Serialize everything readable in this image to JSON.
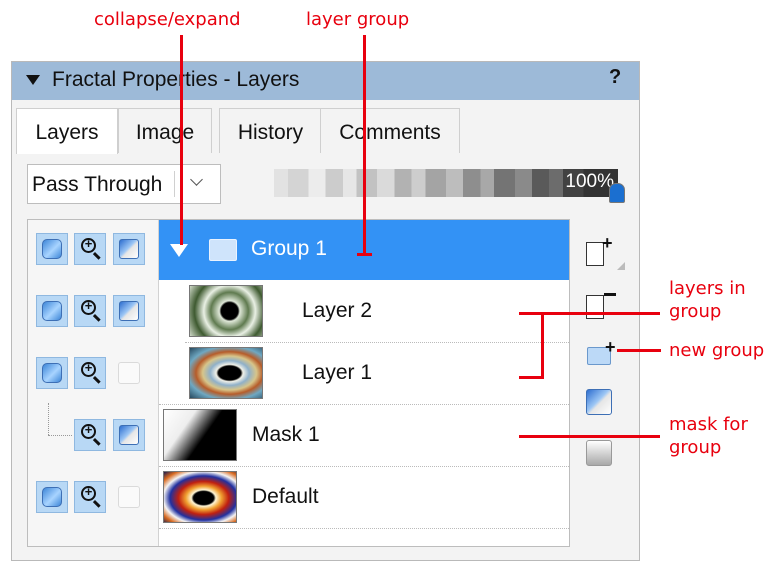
{
  "annotations": {
    "collapse_expand": "collapse/expand",
    "layer_group": "layer group",
    "layers_in_group_1": "layers in",
    "layers_in_group_2": "group",
    "new_group": "new group",
    "mask_for_group_1": "mask for",
    "mask_for_group_2": "group"
  },
  "panel": {
    "title": "Fractal Properties - Layers",
    "help": "?"
  },
  "tabs": [
    {
      "label": "Layers",
      "active": true
    },
    {
      "label": "Image",
      "active": false
    },
    {
      "label": "History",
      "active": false
    },
    {
      "label": "Comments",
      "active": false
    }
  ],
  "blend_mode": {
    "value": "Pass Through"
  },
  "opacity": {
    "label": "100%",
    "value": 1.0
  },
  "layers": [
    {
      "name": "Group 1",
      "type": "group",
      "selected": true,
      "expanded": true
    },
    {
      "name": "Layer 2",
      "type": "layer",
      "in_group": true
    },
    {
      "name": "Layer 1",
      "type": "layer",
      "in_group": true
    },
    {
      "name": "Mask 1",
      "type": "mask"
    },
    {
      "name": "Default",
      "type": "layer"
    }
  ],
  "icons": {
    "visibility": "eye-icon",
    "zoom": "zoom-in-icon",
    "mask": "mask-icon",
    "new_layer": "new-layer-icon",
    "delete_layer": "delete-layer-icon",
    "new_group": "new-group-icon",
    "add_mask": "add-mask-icon",
    "merge": "merge-icon"
  },
  "colors": {
    "annotation": "#e8000e",
    "title_bar": "#9dbad8",
    "selection": "#3392f5"
  }
}
